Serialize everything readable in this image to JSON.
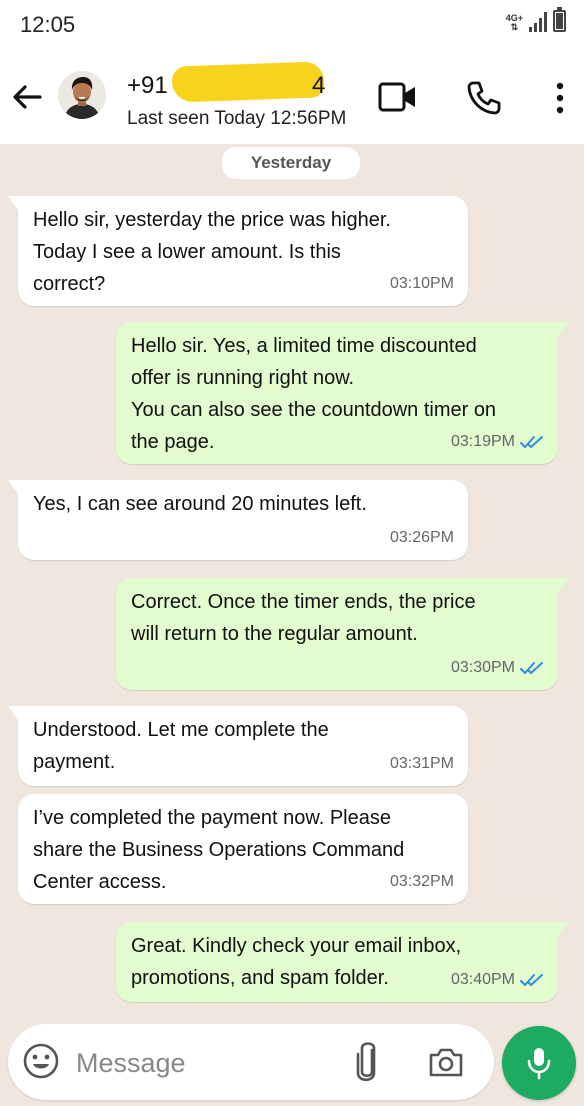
{
  "status_bar": {
    "time": "12:05",
    "network": "4G+"
  },
  "header": {
    "name_prefix": "+91 ",
    "name_suffix": "4",
    "last_seen": "Last seen Today 12:56PM",
    "icons": [
      "back-arrow-icon",
      "avatar",
      "video-call-icon",
      "phone-icon",
      "more-vert-icon"
    ]
  },
  "chat": {
    "date_chip": "Yesterday",
    "messages": [
      {
        "direction": "in",
        "text": "Hello sir, yesterday the price was higher.\nToday I see a lower amount. Is this\ncorrect?",
        "time": "03:10PM"
      },
      {
        "direction": "out",
        "text": "Hello sir. Yes, a limited time discounted\noffer is running right now.\nYou can also see the countdown timer on\nthe page.",
        "time": "03:19PM",
        "status": "read"
      },
      {
        "direction": "in",
        "text": "Yes, I can see around 20 minutes left.",
        "time": "03:26PM"
      },
      {
        "direction": "out",
        "text": "Correct. Once the timer ends, the price\nwill return to the regular amount.",
        "time": "03:30PM",
        "status": "read"
      },
      {
        "direction": "in",
        "text": "Understood. Let me complete the\npayment.",
        "time": "03:31PM"
      },
      {
        "direction": "in",
        "text": "I’ve completed the payment now. Please\nshare the Business Operations Command\nCenter access.",
        "time": "03:32PM"
      },
      {
        "direction": "out",
        "text": "Great. Kindly check your email inbox,\npromotions, and spam folder.",
        "time": "03:40PM",
        "status": "read"
      }
    ]
  },
  "composer": {
    "placeholder": "Message"
  },
  "colors": {
    "incoming": "#ffffff",
    "outgoing": "#e2fccf",
    "accent": "#1daa61",
    "read_ticks": "#2f8fd8",
    "wallpaper": "#efe7de"
  }
}
